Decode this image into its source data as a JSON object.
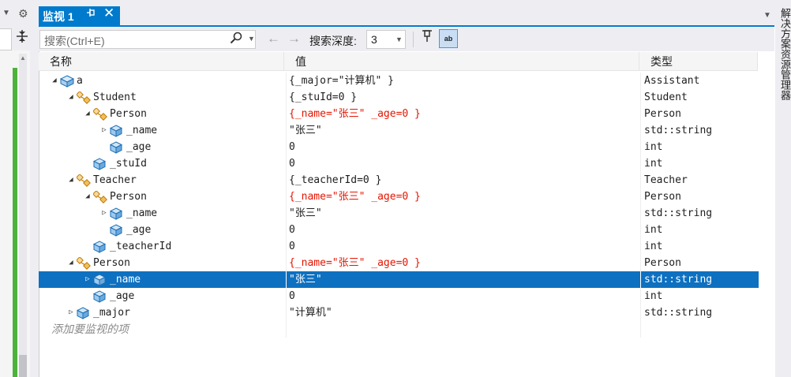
{
  "left": {
    "caret": "▼",
    "gear": "⚙",
    "split": "⊕"
  },
  "tab": {
    "title": "监视 1",
    "pin": "⊣",
    "close": "✕"
  },
  "toolbar": {
    "search_placeholder": "搜索(Ctrl+E)",
    "depth_label": "搜索深度:",
    "depth_value": "3",
    "hex_label": "ab"
  },
  "columns": {
    "name": "名称",
    "value": "值",
    "type": "类型"
  },
  "rows": [
    {
      "name": "a",
      "value": "{_major=\"计算机\" }",
      "type": "Assistant",
      "level": 0,
      "expander": "expanded",
      "icon": "class",
      "changed": false,
      "selected": false
    },
    {
      "name": "Student",
      "value": "{_stuId=0 }",
      "type": "Student",
      "level": 1,
      "expander": "expanded",
      "icon": "base",
      "changed": false,
      "selected": false
    },
    {
      "name": "Person",
      "value": "{_name=\"张三\" _age=0 }",
      "type": "Person",
      "level": 2,
      "expander": "expanded",
      "icon": "base",
      "changed": true,
      "selected": false
    },
    {
      "name": "_name",
      "value": "\"张三\"",
      "type": "std::string",
      "level": 3,
      "expander": "collapsed",
      "icon": "field",
      "changed": false,
      "selected": false
    },
    {
      "name": "_age",
      "value": "0",
      "type": "int",
      "level": 3,
      "expander": "none",
      "icon": "field",
      "changed": false,
      "selected": false
    },
    {
      "name": "_stuId",
      "value": "0",
      "type": "int",
      "level": 2,
      "expander": "none",
      "icon": "field",
      "changed": false,
      "selected": false
    },
    {
      "name": "Teacher",
      "value": "{_teacherId=0 }",
      "type": "Teacher",
      "level": 1,
      "expander": "expanded",
      "icon": "base",
      "changed": false,
      "selected": false
    },
    {
      "name": "Person",
      "value": "{_name=\"张三\" _age=0 }",
      "type": "Person",
      "level": 2,
      "expander": "expanded",
      "icon": "base",
      "changed": true,
      "selected": false
    },
    {
      "name": "_name",
      "value": "\"张三\"",
      "type": "std::string",
      "level": 3,
      "expander": "collapsed",
      "icon": "field",
      "changed": false,
      "selected": false
    },
    {
      "name": "_age",
      "value": "0",
      "type": "int",
      "level": 3,
      "expander": "none",
      "icon": "field",
      "changed": false,
      "selected": false
    },
    {
      "name": "_teacherId",
      "value": "0",
      "type": "int",
      "level": 2,
      "expander": "none",
      "icon": "field",
      "changed": false,
      "selected": false
    },
    {
      "name": "Person",
      "value": "{_name=\"张三\" _age=0 }",
      "type": "Person",
      "level": 1,
      "expander": "expanded",
      "icon": "base",
      "changed": true,
      "selected": false
    },
    {
      "name": "_name",
      "value": "\"张三\"",
      "type": "std::string",
      "level": 2,
      "expander": "collapsed",
      "icon": "field",
      "changed": false,
      "selected": true
    },
    {
      "name": "_age",
      "value": "0",
      "type": "int",
      "level": 2,
      "expander": "none",
      "icon": "field",
      "changed": false,
      "selected": false
    },
    {
      "name": "_major",
      "value": "\"计算机\"",
      "type": "std::string",
      "level": 1,
      "expander": "collapsed",
      "icon": "field",
      "changed": false,
      "selected": false
    }
  ],
  "add_watch_hint": "添加要监视的项",
  "right_panel": {
    "title": "解决方案资源管理器"
  },
  "colors": {
    "accent": "#007acc",
    "selection": "#0e70c0",
    "changed_value": "#e51400",
    "green_bar": "#4bb33a"
  }
}
